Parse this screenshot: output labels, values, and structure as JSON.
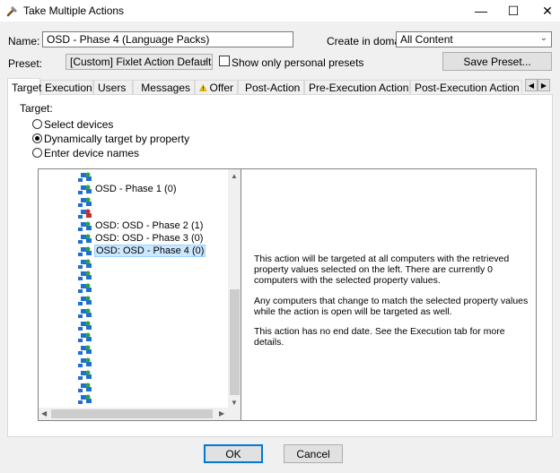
{
  "window": {
    "title": "Take Multiple Actions"
  },
  "form": {
    "name_label": "Name:",
    "name_value": "OSD - Phase 4 (Language Packs)",
    "domain_label": "Create in domain:",
    "domain_value": "All Content",
    "preset_label": "Preset:",
    "preset_value": "[Custom] Fixlet Action Defaults",
    "personal_presets_label": "Show only personal presets",
    "save_preset_label": "Save Preset..."
  },
  "tabs": [
    {
      "label": "Target",
      "warning": false
    },
    {
      "label": "Execution",
      "warning": true
    },
    {
      "label": "Users",
      "warning": true
    },
    {
      "label": "Messages",
      "warning": true
    },
    {
      "label": "Offer",
      "warning": true
    },
    {
      "label": "Post-Action",
      "warning": false
    },
    {
      "label": "Pre-Execution Action Script",
      "warning": false
    },
    {
      "label": "Post-Execution Action Script",
      "warning": false
    }
  ],
  "target": {
    "heading": "Target:",
    "options": [
      "Select devices",
      "Dynamically target by property",
      "Enter device names"
    ],
    "selected_option": "Dynamically target by property"
  },
  "tree": {
    "items": [
      "OSD - Phase 1 (0)",
      "OSD: OSD - Phase 2 (1)",
      "OSD: OSD - Phase 3 (0)",
      "OSD: OSD - Phase 4 (0)"
    ],
    "selected": "OSD: OSD - Phase 4 (0)"
  },
  "description": {
    "p1": "This action will be targeted at all computers with the retrieved property values selected on the left. There are currently 0 computers with the selected property values.",
    "p2": "Any computers that change to match the selected property values while the action is open will be targeted as well.",
    "p3": "This action has no end date. See the Execution tab for more details."
  },
  "buttons": {
    "ok": "OK",
    "cancel": "Cancel"
  },
  "colors": {
    "accent": "#0078d7",
    "selection": "#cce8ff",
    "warning": "#f5c400"
  }
}
